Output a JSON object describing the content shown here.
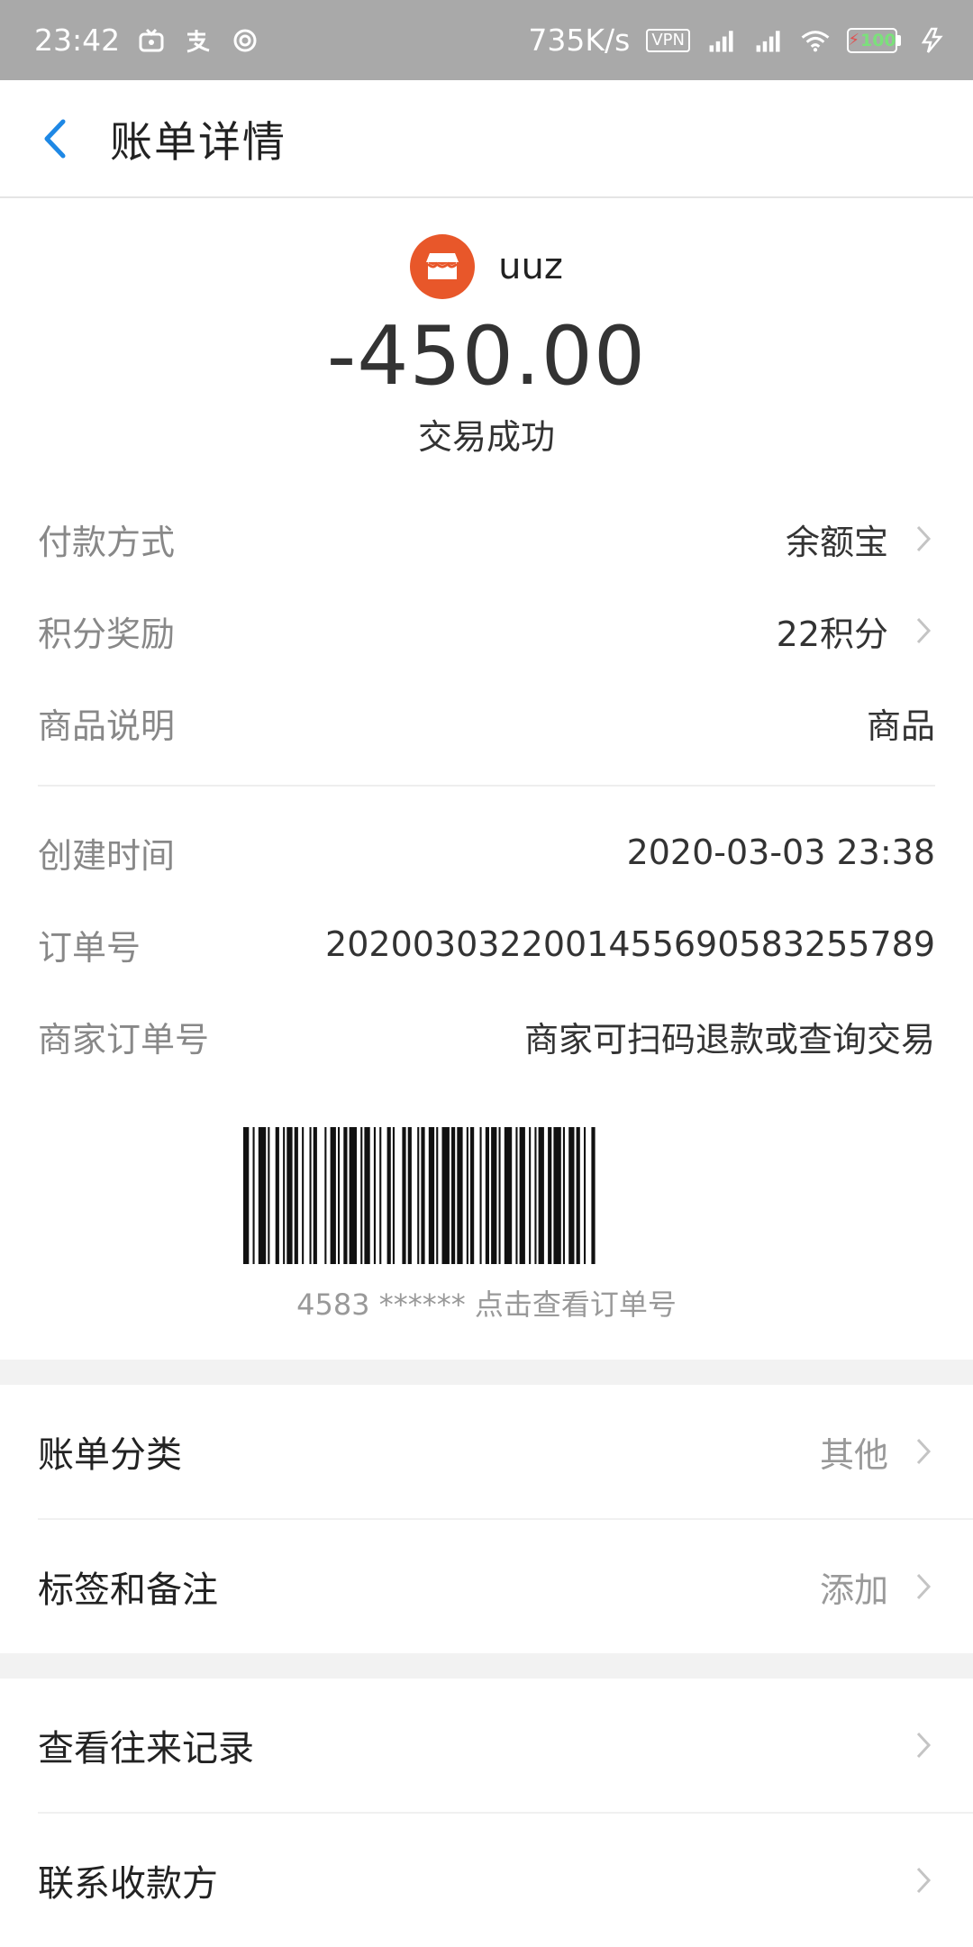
{
  "status_bar": {
    "time": "23:42",
    "net_speed": "735K/s",
    "vpn": "VPN",
    "battery": "100"
  },
  "header": {
    "title": "账单详情"
  },
  "summary": {
    "merchant": "uuz",
    "amount": "-450.00",
    "status": "交易成功"
  },
  "info_rows": [
    {
      "label": "付款方式",
      "value": "余额宝"
    },
    {
      "label": "积分奖励",
      "value": "22积分"
    },
    {
      "label": "商品说明",
      "value": "商品"
    },
    {
      "label": "创建时间",
      "value": "2020-03-03 23:38"
    },
    {
      "label": "订单号",
      "value": "2020030322001455690583255789"
    },
    {
      "label": "商家订单号",
      "value": "商家可扫码退款或查询交易"
    }
  ],
  "barcode": {
    "caption": "4583 ****** 点击查看订单号"
  },
  "options": [
    {
      "label": "账单分类",
      "value": "其他"
    },
    {
      "label": "标签和备注",
      "value": "添加"
    },
    {
      "label": "查看往来记录"
    },
    {
      "label": "联系收款方"
    }
  ],
  "colors": {
    "accent": "#1e88e5",
    "merchant_logo": "#e8572a",
    "status_bar": "#a9a9a9"
  }
}
